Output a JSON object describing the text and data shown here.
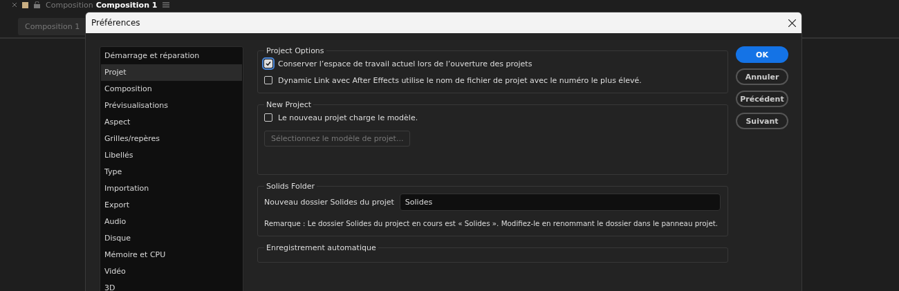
{
  "app": {
    "panel_tabs": [
      {
        "label": "Composition",
        "selected": false
      },
      {
        "label": "Composition 1",
        "selected": true
      }
    ],
    "viewer_tab": "Composition 1"
  },
  "dialog": {
    "title": "Préférences",
    "sidebar": {
      "items": [
        {
          "label": "Démarrage et réparation",
          "selected": false
        },
        {
          "label": "Projet",
          "selected": true
        },
        {
          "label": "Composition",
          "selected": false
        },
        {
          "label": "Prévisualisations",
          "selected": false
        },
        {
          "label": "Aspect",
          "selected": false
        },
        {
          "label": "Grilles/repères",
          "selected": false
        },
        {
          "label": "Libellés",
          "selected": false
        },
        {
          "label": "Type",
          "selected": false
        },
        {
          "label": "Importation",
          "selected": false
        },
        {
          "label": "Export",
          "selected": false
        },
        {
          "label": "Audio",
          "selected": false
        },
        {
          "label": "Disque",
          "selected": false
        },
        {
          "label": "Mémoire et CPU",
          "selected": false
        },
        {
          "label": "Vidéo",
          "selected": false
        },
        {
          "label": "3D",
          "selected": false
        }
      ]
    },
    "sections": [
      {
        "title": "Project Options",
        "rows": [
          {
            "kind": "checkbox",
            "label": "Conserver l’espace de travail actuel lors de l’ouverture des projets",
            "checked": true
          },
          {
            "kind": "checkbox",
            "label": "Dynamic Link avec After Effects utilise le nom de fichier de projet avec le numéro le plus élevé.",
            "checked": false
          }
        ]
      },
      {
        "title": "New Project",
        "rows": [
          {
            "kind": "checkbox",
            "label": "Le nouveau projet charge le modèle.",
            "checked": false
          },
          {
            "kind": "button",
            "label": "Sélectionnez le modèle de projet...",
            "disabled": true
          }
        ]
      },
      {
        "title": "Solids Folder",
        "rows": [
          {
            "kind": "field",
            "label": "Nouveau dossier Solides du projet",
            "value": "Solides"
          },
          {
            "kind": "note",
            "label": "Remarque : Le dossier Solides du project en cours est « Solides ». Modifiez-le en renommant le dossier dans le panneau projet."
          }
        ]
      },
      {
        "title": "Enregistrement automatique"
      }
    ],
    "buttons": [
      {
        "label": "OK",
        "primary": true
      },
      {
        "label": "Annuler",
        "primary": false
      },
      {
        "label": "Précédent",
        "primary": false
      },
      {
        "label": "Suivant",
        "primary": false
      }
    ]
  }
}
